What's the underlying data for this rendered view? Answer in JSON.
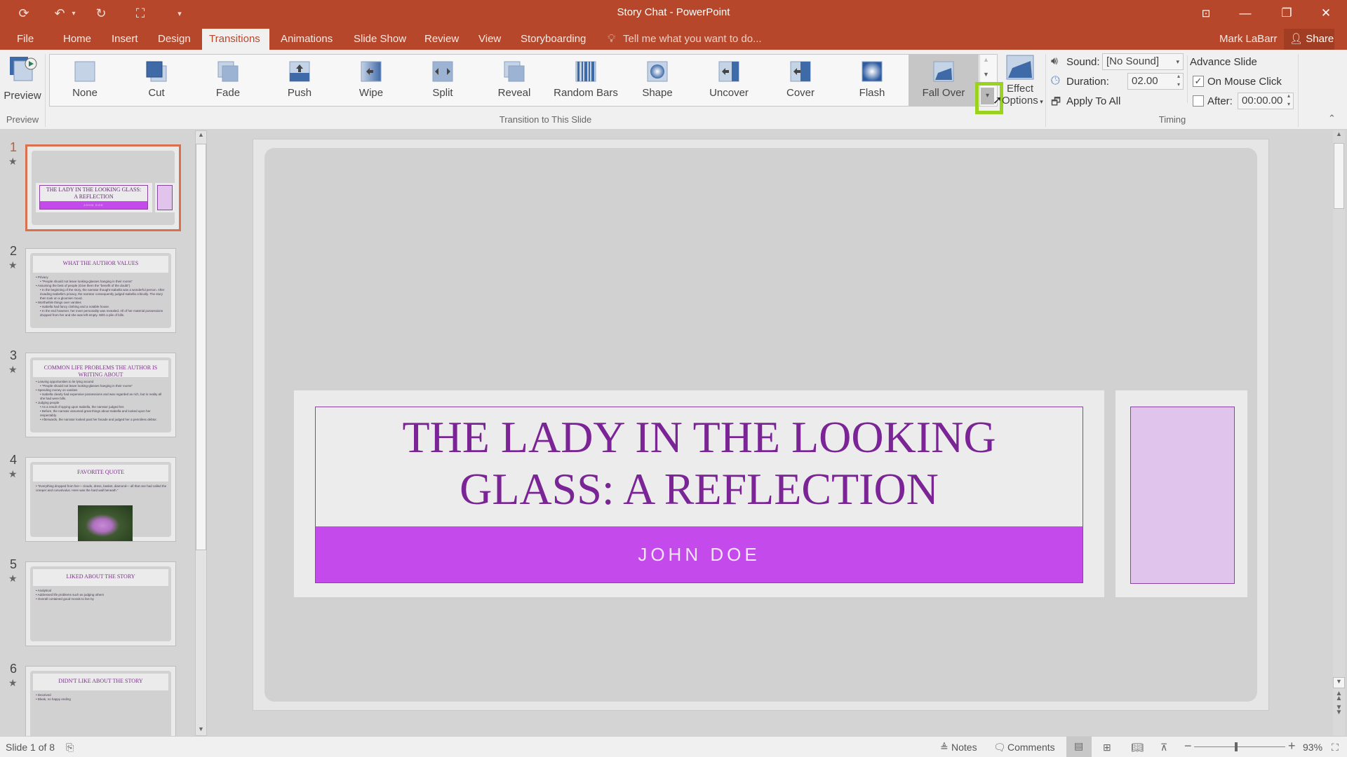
{
  "app": {
    "window_title": "Story Chat - PowerPoint",
    "user_name": "Mark LaBarr",
    "share_label": "Share",
    "tell_me_placeholder": "Tell me what you want to do..."
  },
  "quick_access": [
    {
      "name": "autosave-icon",
      "glyph": "⟳"
    },
    {
      "name": "undo-icon",
      "glyph": "↶"
    },
    {
      "name": "redo-icon",
      "glyph": "↻"
    },
    {
      "name": "start-from-beginning-icon",
      "glyph": "⛶"
    },
    {
      "name": "customize-qat-icon",
      "glyph": "▾"
    }
  ],
  "window_controls": {
    "ribbon_display": "⊡",
    "minimize": "—",
    "restore": "❐",
    "close": "✕"
  },
  "tabs": [
    {
      "label": "File",
      "active": false
    },
    {
      "label": "Home",
      "active": false
    },
    {
      "label": "Insert",
      "active": false
    },
    {
      "label": "Design",
      "active": false
    },
    {
      "label": "Transitions",
      "active": true
    },
    {
      "label": "Animations",
      "active": false
    },
    {
      "label": "Slide Show",
      "active": false
    },
    {
      "label": "Review",
      "active": false
    },
    {
      "label": "View",
      "active": false
    },
    {
      "label": "Storyboarding",
      "active": false
    }
  ],
  "ribbon": {
    "preview": {
      "button_label": "Preview",
      "group_label": "Preview"
    },
    "transitions": {
      "group_label": "Transition to This Slide",
      "items": [
        {
          "label": "None",
          "icon": "none-transition-icon"
        },
        {
          "label": "Cut",
          "icon": "cut-transition-icon"
        },
        {
          "label": "Fade",
          "icon": "fade-transition-icon"
        },
        {
          "label": "Push",
          "icon": "push-transition-icon"
        },
        {
          "label": "Wipe",
          "icon": "wipe-transition-icon"
        },
        {
          "label": "Split",
          "icon": "split-transition-icon"
        },
        {
          "label": "Reveal",
          "icon": "reveal-transition-icon"
        },
        {
          "label": "Random Bars",
          "icon": "random-bars-transition-icon"
        },
        {
          "label": "Shape",
          "icon": "shape-transition-icon"
        },
        {
          "label": "Uncover",
          "icon": "uncover-transition-icon"
        },
        {
          "label": "Cover",
          "icon": "cover-transition-icon"
        },
        {
          "label": "Flash",
          "icon": "flash-transition-icon"
        },
        {
          "label": "Fall Over",
          "icon": "fall-over-transition-icon",
          "selected": true
        }
      ],
      "effect_options_line1": "Effect",
      "effect_options_line2": "Options"
    },
    "timing": {
      "group_label": "Timing",
      "sound_label": "Sound:",
      "sound_value": "[No Sound]",
      "duration_label": "Duration:",
      "duration_value": "02.00",
      "apply_all_label": "Apply To All",
      "advance_title": "Advance Slide",
      "on_mouse_click_label": "On Mouse Click",
      "on_mouse_click_checked": true,
      "after_label": "After:",
      "after_checked": false,
      "after_value": "00:00.00"
    }
  },
  "thumbnails": [
    {
      "number": "1",
      "title": "THE LADY IN THE LOOKING GLASS: A REFLECTION",
      "subtitle": "JOHN DOE",
      "selected": true
    },
    {
      "number": "2",
      "title": "WHAT THE AUTHOR VALUES",
      "bullets": [
        "Privacy",
        "  “People should not leave looking-glasses hanging in their rooms”",
        "Assuming the best of people (Give them the “benefit of the doubt”)",
        "  In the beginning of the story, the narrator thought Isabella was a wonderful person. After invading Isabella's privacy, the narrator consequently judged Isabella critically. The story then took on a gloomier mood.",
        "Worthwhile things over vanities",
        "  Isabella had fancy clothing and a notable house.",
        "  In the end however, her inner personality was revealed. All of her material possessions dropped from her and she was left empty. With a pile of bills."
      ]
    },
    {
      "number": "3",
      "title": "COMMON LIFE PROBLEMS THE AUTHOR IS WRITING ABOUT",
      "bullets": [
        "Leaving opportunities to lie lying around",
        "  “People should not leave looking-glasses hanging in their rooms”",
        "Spending money on vanities",
        "  Isabella clearly had expensive possessions and was regarded as rich, but in reality all she had were bills.",
        "Judging people",
        "  As a result of spying upon Isabella, the narrator judged her.",
        "  Before, the narrator assumed great things about Isabella and looked upon her respectably.",
        "  Afterwards, the narrator looked past her facade and judged her a penniless debtor."
      ]
    },
    {
      "number": "4",
      "title": "FAVORITE QUOTE",
      "bullets": [
        "“Everything dropped from her— clouds, dress, basket, diamond— all that one had called the creeper and convolvulus. Here was the hard wall beneath.”"
      ],
      "has_image": true
    },
    {
      "number": "5",
      "title": "LIKED ABOUT THE STORY",
      "bullets": [
        "Analytical",
        "Addressed life problems such as judging others",
        "Overall contained good morals to live by"
      ]
    },
    {
      "number": "6",
      "title": "DIDN'T LIKE ABOUT THE STORY",
      "bullets": [
        "Deceived",
        "Bleak, no happy ending"
      ]
    }
  ],
  "slide": {
    "title": "THE LADY IN THE LOOKING GLASS: A REFLECTION",
    "subtitle": "JOHN DOE"
  },
  "status": {
    "slide_indicator": "Slide 1 of 8",
    "notes_label": "Notes",
    "comments_label": "Comments",
    "zoom_level": "93%",
    "zoom_percent": 93
  },
  "colors": {
    "brand": "#b7472a",
    "title_purple": "#7a2496",
    "subtitle_band": "#c54aec",
    "side_box": "#e0c4ec",
    "highlight": "#9bd11f",
    "thumb_selected": "#d9714f"
  }
}
